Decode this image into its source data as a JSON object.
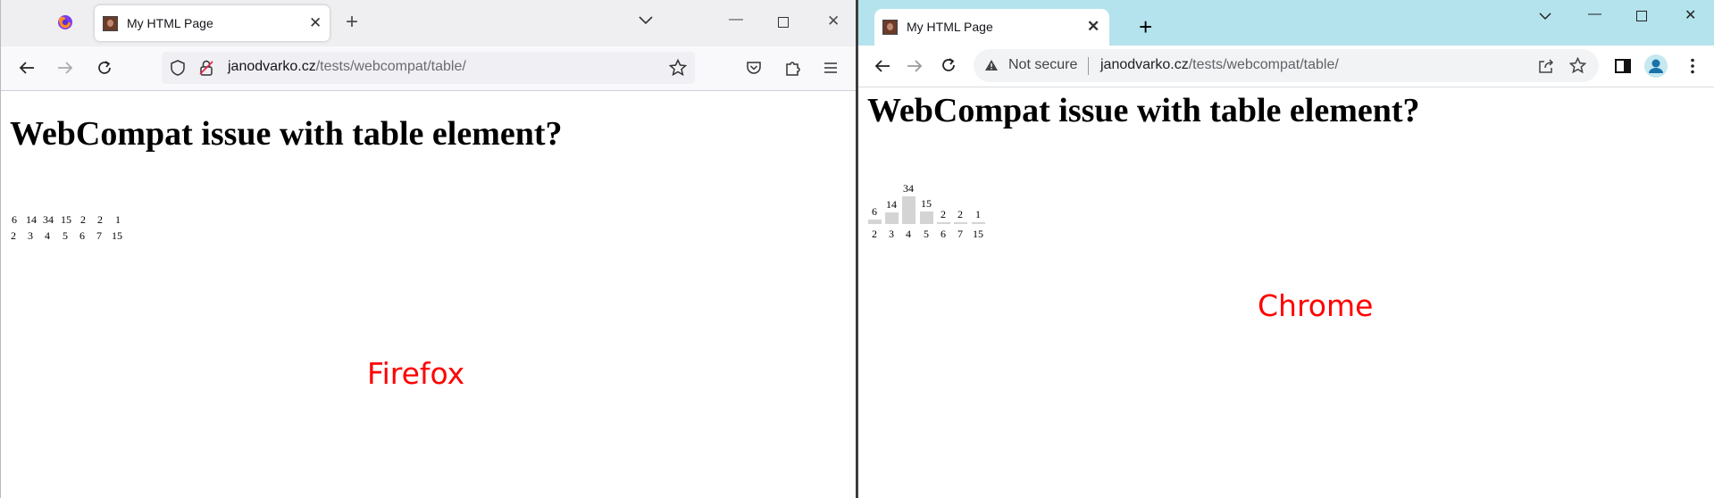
{
  "firefox": {
    "tab_title": "My HTML Page",
    "url_host": "janodvarko.cz",
    "url_path": "/tests/webcompat/table/",
    "heading": "WebCompat issue with table element?",
    "caption": "Firefox"
  },
  "chrome": {
    "tab_title": "My HTML Page",
    "not_secure": "Not secure",
    "url_host": "janodvarko.cz",
    "url_path": "/tests/webcompat/table/",
    "heading": "WebCompat issue with table element?",
    "caption": "Chrome"
  },
  "table": {
    "values": [
      "6",
      "14",
      "34",
      "15",
      "2",
      "2",
      "1"
    ],
    "labels": [
      "2",
      "3",
      "4",
      "5",
      "6",
      "7",
      "15"
    ],
    "value_numbers": [
      6,
      14,
      34,
      15,
      2,
      2,
      1
    ]
  },
  "icons": {
    "ff_logo": "firefox-logo-icon",
    "back": "arrow-left-icon",
    "forward": "arrow-right-icon",
    "reload": "reload-icon",
    "shield": "shield-icon",
    "lock_warning": "insecure-lock-icon",
    "star": "star-icon",
    "pocket": "pocket-icon",
    "extensions": "puzzle-icon",
    "menu": "hamburger-menu-icon",
    "tab_list": "chevron-down-icon",
    "minimize": "minimize-icon",
    "maximize": "maximize-icon",
    "close": "close-icon",
    "new_tab": "plus-icon",
    "warning": "warning-triangle-icon",
    "share": "share-icon",
    "side_panel": "side-panel-icon",
    "profile": "profile-avatar-icon",
    "kebab": "kebab-menu-icon"
  },
  "colors": {
    "caption": "#ff0000",
    "chrome_frame": "#b4e3ed",
    "bar": "#d4d4d4"
  }
}
